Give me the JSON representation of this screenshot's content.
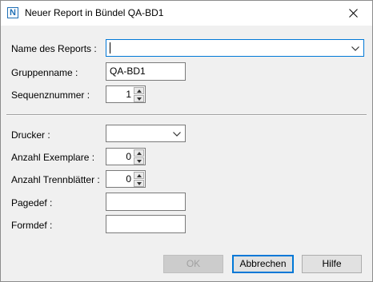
{
  "window": {
    "icon_letter": "N",
    "title": "Neuer Report in Bündel QA-BD1"
  },
  "form": {
    "report_name": {
      "label": "Name des Reports :",
      "value": ""
    },
    "group_name": {
      "label": "Gruppenname :",
      "value": "QA-BD1"
    },
    "sequence": {
      "label": "Sequenznummer :",
      "value": "1"
    },
    "printer": {
      "label": "Drucker :",
      "value": ""
    },
    "copies": {
      "label": "Anzahl Exemplare :",
      "value": "0"
    },
    "separators": {
      "label": "Anzahl Trennblätter :",
      "value": "0"
    },
    "pagedef": {
      "label": "Pagedef :",
      "value": ""
    },
    "formdef": {
      "label": "Formdef :",
      "value": ""
    }
  },
  "buttons": {
    "ok": "OK",
    "cancel": "Abbrechen",
    "help": "Hilfe"
  },
  "colors": {
    "accent": "#0078d7",
    "dialog_bg": "#f0f0f0"
  }
}
